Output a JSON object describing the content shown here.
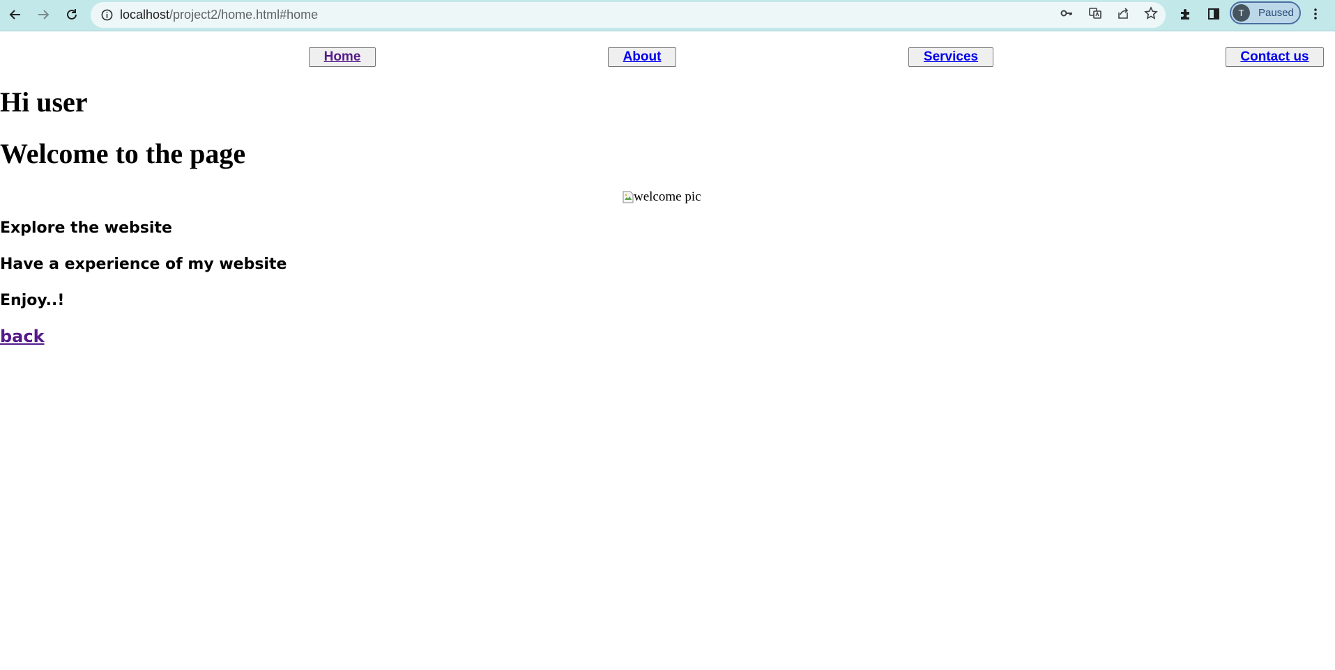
{
  "browser": {
    "url_host": "localhost",
    "url_path": "/project2/home.html#home",
    "profile_initial": "T",
    "profile_status": "Paused",
    "icons": [
      "back-arrow-icon",
      "forward-arrow-icon",
      "reload-icon",
      "site-info-icon",
      "key-icon",
      "translate-icon",
      "share-icon",
      "star-icon",
      "extensions-icon",
      "side-panel-icon",
      "menu-icon"
    ]
  },
  "nav": {
    "items": [
      {
        "label": "Home"
      },
      {
        "label": "About"
      },
      {
        "label": "Services"
      },
      {
        "label": "Contact us"
      }
    ]
  },
  "main": {
    "greeting": "Hi user",
    "welcome": "Welcome to the page",
    "image_alt": "welcome pic",
    "lines": [
      "Explore the website",
      "Have a experience of my website",
      "Enjoy..!"
    ],
    "back_link": "back"
  },
  "colors": {
    "link": "#0000ee",
    "visited_link": "#551a8b",
    "chrome_bg": "#c2e8ea"
  }
}
